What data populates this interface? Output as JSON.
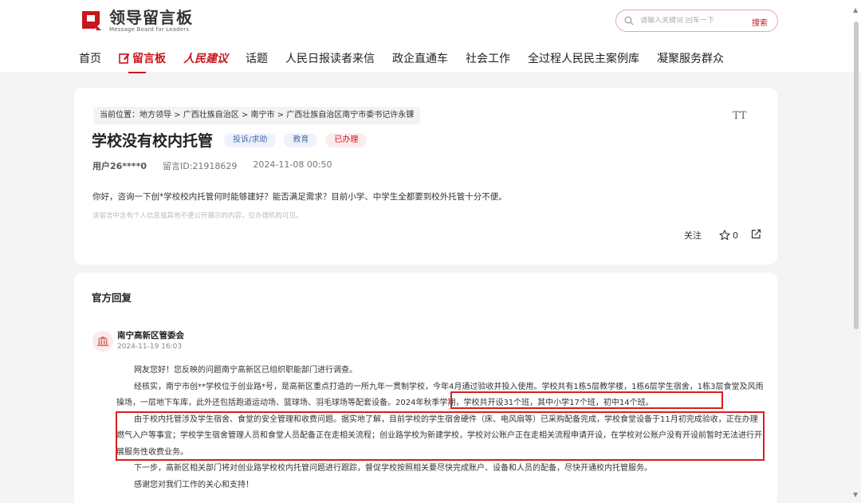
{
  "brand": {
    "title": "领导留言板",
    "subtitle": "Message Board for Leaders",
    "accent": "#c8161d"
  },
  "search": {
    "placeholder": "请输入关键词 回车一下",
    "button": "搜索"
  },
  "nav": {
    "items": [
      {
        "label": "首页"
      },
      {
        "label": "留言板",
        "active": true
      },
      {
        "label": "人民建议"
      },
      {
        "label": "话题"
      },
      {
        "label": "人民日报读者来信"
      },
      {
        "label": "政企直通车"
      },
      {
        "label": "社会工作"
      },
      {
        "label": "全过程人民民主案例库"
      },
      {
        "label": "凝聚服务群众"
      }
    ]
  },
  "message": {
    "breadcrumb": "当前位置：地方领导 > 广西壮族自治区 > 南宁市 > 广西壮族自治区南宁市委书记许永锞",
    "font_size_icon": "TT",
    "title": "学校没有校内托管",
    "tags": [
      "投诉/求助",
      "教育",
      "已办理"
    ],
    "user": "用户26****0",
    "message_id": "留言ID:21918629",
    "time": "2024-11-08 00:50",
    "content": "你好，咨询一下创*学校校内托管何时能够建好？能否满足需求？目前小学、中学生全都要到校外托管十分不便。",
    "privacy_note": "该留言中含有个人信息或其他不便公开展示的内容，仅办理机构可见。",
    "follow_label": "关注",
    "star_count": "0"
  },
  "reply": {
    "section_title": "官方回复",
    "org": "南宁高新区管委会",
    "date": "2024-11-19 16:03",
    "paragraphs": [
      "网友您好！您反映的问题南宁高新区已组织职能部门进行调查。",
      "经核实，南宁市创**学校位于创业路*号，是高新区重点打造的一所九年一贯制学校，今年4月通过验收并投入使用。学校共有1栋5层教学楼，1栋6层学生宿舍，1栋3层食堂及风雨操场，一层地下车库，此外还包括跑道运动场、篮球场、羽毛球场等配套设备。2024年秋季学期，学校共开设31个班，其中小学17个班，初中14个班。",
      "由于校内托管涉及学生宿舍、食堂的安全管理和收费问题。据实地了解，目前学校的学生宿舍硬件（床、电风扇等）已采购配备完成，学校食堂设备于11月初完成验收，正在办理燃气入户等事宜；学校学生宿舍管理人员和食堂人员配备正在走相关流程；创业路学校为新建学校，学校对公账户正在走相关流程申请开设，在学校对公账户没有开设前暂时无法进行开展服务性收费业务。",
      "下一步，高新区相关部门将对创业路学校校内托管问题进行跟踪，督促学校按照相关要尽快完成账户、设备和人员的配备，尽快开通校内托管服务。",
      "感谢您对我们工作的关心和支持！"
    ]
  }
}
